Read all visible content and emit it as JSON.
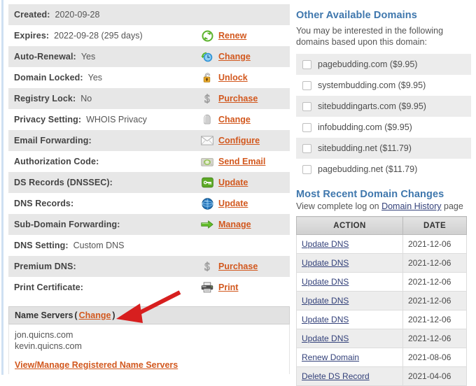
{
  "left_panel": {
    "rows": [
      {
        "label": "Created:",
        "value": "2020-09-28",
        "action": null,
        "icon": null
      },
      {
        "label": "Expires:",
        "value": "2022-09-28 (295 days)",
        "action": "Renew",
        "icon": "renew-refresh-icon"
      },
      {
        "label": "Auto-Renewal:",
        "value": "Yes",
        "action": "Change",
        "icon": "auto-renew-clock-icon"
      },
      {
        "label": "Domain Locked:",
        "value": "Yes",
        "action": "Unlock",
        "icon": "padlock-icon"
      },
      {
        "label": "Registry Lock:",
        "value": "No",
        "action": "Purchase",
        "icon": "dollar-sign-icon"
      },
      {
        "label": "Privacy Setting:",
        "value": "WHOIS Privacy",
        "action": "Change",
        "icon": "privacy-hood-icon"
      },
      {
        "label": "Email Forwarding:",
        "value": "",
        "action": "Configure",
        "icon": "envelope-icon"
      },
      {
        "label": "Authorization Code:",
        "value": "",
        "action": "Send Email",
        "icon": "send-email-icon"
      },
      {
        "label": "DS Records (DNSSEC):",
        "value": "",
        "action": "Update",
        "icon": "key-icon"
      },
      {
        "label": "DNS Records:",
        "value": "",
        "action": "Update",
        "icon": "globe-icon"
      },
      {
        "label": "Sub-Domain Forwarding:",
        "value": "",
        "action": "Manage",
        "icon": "green-arrow-icon"
      },
      {
        "label": "DNS Setting:",
        "value": "Custom DNS",
        "action": null,
        "icon": null
      },
      {
        "label": "Premium DNS:",
        "value": "",
        "action": "Purchase",
        "icon": "dollar-sign-icon"
      },
      {
        "label": "Print Certificate:",
        "value": "",
        "action": "Print",
        "icon": "printer-icon"
      }
    ],
    "nameservers": {
      "title": "Name Servers",
      "change_link": "Change",
      "open_paren": "(",
      "close_paren": ")",
      "entries": [
        "jon.quicns.com",
        "kevin.quicns.com"
      ],
      "manage_link": "View/Manage Registered Name Servers"
    }
  },
  "right_panel": {
    "available_domains": {
      "heading": "Other Available Domains",
      "description": "You may be interested in the following domains based upon this domain:",
      "items": [
        {
          "name": "pagebudding.com ($9.95)",
          "checked": false
        },
        {
          "name": "systembudding.com ($9.95)",
          "checked": false
        },
        {
          "name": "sitebuddingarts.com ($9.95)",
          "checked": false
        },
        {
          "name": "infobudding.com ($9.95)",
          "checked": false
        },
        {
          "name": "sitebudding.net ($11.79)",
          "checked": false
        },
        {
          "name": "pagebudding.net ($11.79)",
          "checked": false
        }
      ]
    },
    "recent_changes": {
      "heading": "Most Recent Domain Changes",
      "sub_prefix": "View complete log on ",
      "sub_link": "Domain History",
      "sub_suffix": " page",
      "columns": [
        "ACTION",
        "DATE"
      ],
      "rows": [
        {
          "action": "Update DNS",
          "date": "2021-12-06"
        },
        {
          "action": "Update DNS",
          "date": "2021-12-06"
        },
        {
          "action": "Update DNS",
          "date": "2021-12-06"
        },
        {
          "action": "Update DNS",
          "date": "2021-12-06"
        },
        {
          "action": "Update DNS",
          "date": "2021-12-06"
        },
        {
          "action": "Update DNS",
          "date": "2021-12-06"
        },
        {
          "action": "Renew Domain",
          "date": "2021-08-06"
        },
        {
          "action": "Delete DS Record",
          "date": "2021-04-06"
        }
      ]
    }
  },
  "annotation": {
    "type": "red-arrow",
    "color": "#d71f1f",
    "points_to": "Change"
  },
  "colors": {
    "action_link": "#d2581e",
    "table_link": "#33417a",
    "heading": "#3f77ad",
    "row_shade": "#e7e7e7",
    "annotation_red": "#d71f1f"
  }
}
